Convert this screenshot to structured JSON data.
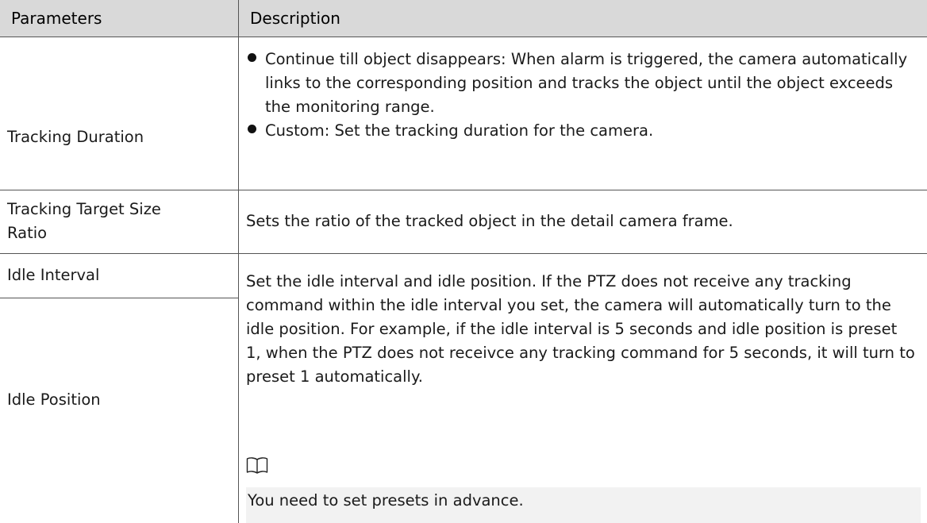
{
  "table": {
    "headers": {
      "parameters": "Parameters",
      "description": "Description"
    },
    "rows": [
      {
        "parameter": "Tracking Duration",
        "bullets": [
          "Continue till object disappears: When alarm is triggered, the camera automatically links to the corresponding position and tracks the object until the object exceeds the monitoring range.",
          "Custom: Set the tracking duration for the camera."
        ]
      },
      {
        "parameter": "Tracking Target Size Ratio",
        "description": "Sets the ratio of the tracked object in the detail camera frame."
      },
      {
        "parameter": "Idle Interval"
      },
      {
        "parameter": "Idle Position",
        "description": "Set the idle interval and idle position. If the PTZ does not receive any tracking command within the idle interval you set, the camera will automatically turn to the idle position. For example, if the idle interval is 5 seconds and idle position is preset 1, when the PTZ does not receivce any tracking command for 5 seconds, it will turn to preset 1 automatically.",
        "note_icon": "book-icon",
        "note": "You need to set presets in advance."
      }
    ]
  },
  "colors": {
    "header_bg": "#d9d9d9",
    "note_bg": "#f2f2f2",
    "rule": "#555555"
  }
}
